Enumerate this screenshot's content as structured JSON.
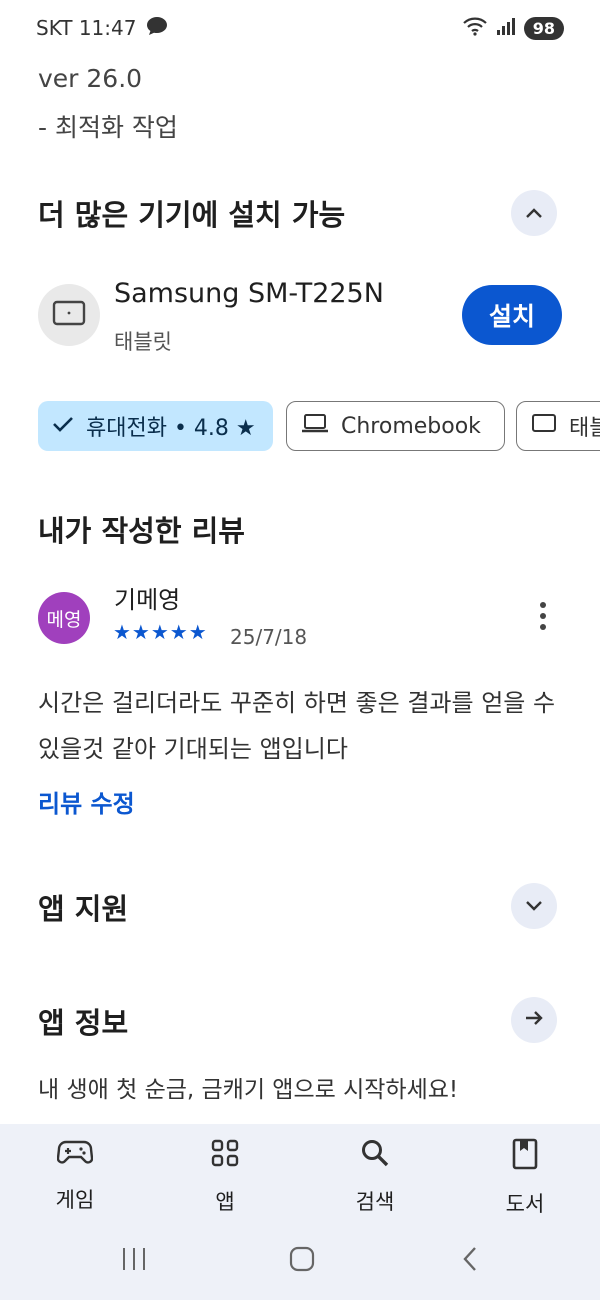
{
  "status_bar": {
    "carrier_time": "SKT 11:47",
    "battery": "98"
  },
  "release_notes": {
    "version": "ver 26.0",
    "note": "- 최적화 작업"
  },
  "more_devices": {
    "title": "더 많은 기기에 설치 가능",
    "device_name": "Samsung SM-T225N",
    "device_type": "태블릿",
    "install_label": "설치"
  },
  "device_chips": [
    {
      "label": "휴대전화 • 4.8 ★",
      "selected": true
    },
    {
      "label": "Chromebook",
      "selected": false
    },
    {
      "label": "태블릿",
      "selected": false
    }
  ],
  "my_review": {
    "title": "내가 작성한 리뷰",
    "avatar_text": "메영",
    "reviewer_name": "기메영",
    "rating": 5,
    "stars_text": "★★★★★",
    "date": "25/7/18",
    "text": "시간은 걸리더라도 꾸준히 하면 좋은 결과를 얻을 수 있을것 같아 기대되는 앱입니다",
    "edit_label": "리뷰 수정"
  },
  "app_support": {
    "title": "앱 지원"
  },
  "app_info": {
    "title": "앱 정보",
    "description": "내 생애 첫 순금, 금캐기 앱으로 시작하세요!"
  },
  "bottom_nav": [
    {
      "label": "게임",
      "icon": "gamepad-icon"
    },
    {
      "label": "앱",
      "icon": "apps-grid-icon"
    },
    {
      "label": "검색",
      "icon": "search-icon"
    },
    {
      "label": "도서",
      "icon": "book-icon"
    }
  ],
  "colors": {
    "accent": "#0b57d0",
    "chip_selected_bg": "#c2e7ff",
    "avatar_bg": "#a040bd",
    "nav_bg": "#eef1f8"
  }
}
